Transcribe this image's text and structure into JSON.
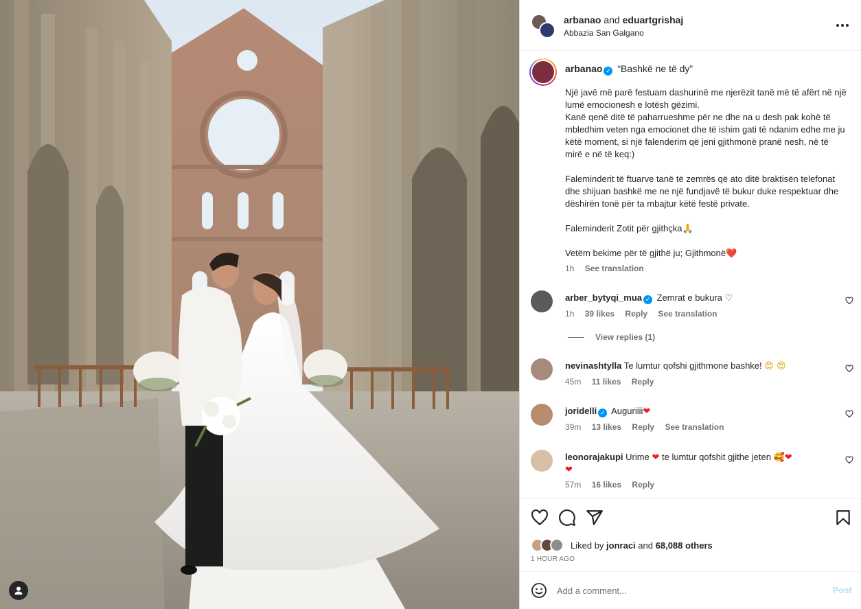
{
  "header": {
    "user1": "arbanao",
    "and_text": "and",
    "user2": "eduartgrishaj",
    "location": "Abbazia San Galgano",
    "more_icon": "more-horizontal-icon"
  },
  "caption": {
    "username": "arbanao",
    "first_line": "“Bashkë ne të dy”",
    "body": "Një javë më parë festuam dashurinë me njerëzit tanë më të afërt në një lumë emocionesh e lotësh gëzimi.\nKanë qenë ditë të paharrueshme për ne dhe na u desh pak kohë të mbledhim veten nga emocionet dhe të ishim gati të ndanim edhe me ju këtë moment, si një falenderim që jeni gjithmonë pranë nesh, në të mirë e në të keq:)\n\nFaleminderit të ftuarve tanë të zemrës që ato ditë braktisën telefonat dhe shijuan bashkë me ne një fundjavë të bukur duke respektuar dhe dëshirën tonë për ta mbajtur këtë festë private.\n\nFaleminderit Zotit për gjithçka🙏\n\nVetëm bekime për të gjithë ju; Gjithmonë❤️",
    "time": "1h",
    "see_translation": "See translation"
  },
  "comments": [
    {
      "username": "arber_bytyqi_mua",
      "verified": true,
      "text": "Zemrat e bukura",
      "emoji": "♡",
      "time": "1h",
      "likes": "39 likes",
      "reply": "Reply",
      "see_translation": "See translation",
      "view_replies": "View replies (1)"
    },
    {
      "username": "nevinashtylla",
      "verified": false,
      "text": "Te lumtur qofshi gjithmone bashke!",
      "emoji": "😍 😍",
      "time": "45m",
      "likes": "11 likes",
      "reply": "Reply"
    },
    {
      "username": "joridelli",
      "verified": true,
      "text": "Auguriiii",
      "emoji": "❤",
      "time": "39m",
      "likes": "13 likes",
      "reply": "Reply",
      "see_translation": "See translation"
    },
    {
      "username": "leonorajakupi",
      "verified": false,
      "text_a": "Urime",
      "emoji_a": "❤",
      "text_b": "te lumtur qofshit gjithe jeten",
      "emoji_b": "🥰",
      "emoji_c": "❤",
      "emoji_d": "❤",
      "time": "57m",
      "likes": "16 likes",
      "reply": "Reply"
    }
  ],
  "actions": {
    "icons": [
      "heart-icon",
      "comment-icon",
      "share-icon",
      "bookmark-icon"
    ],
    "liked_prefix": "Liked by",
    "liked_user": "jonraci",
    "liked_and": "and",
    "liked_others": "68,088 others",
    "time_ago": "1 HOUR AGO"
  },
  "add_comment": {
    "placeholder": "Add a comment...",
    "post_label": "Post"
  },
  "colors": {
    "link_blue": "#0095f6",
    "post_disabled": "#b2dffc",
    "secondary_text": "#737373",
    "heart_red": "#ed1c24"
  }
}
